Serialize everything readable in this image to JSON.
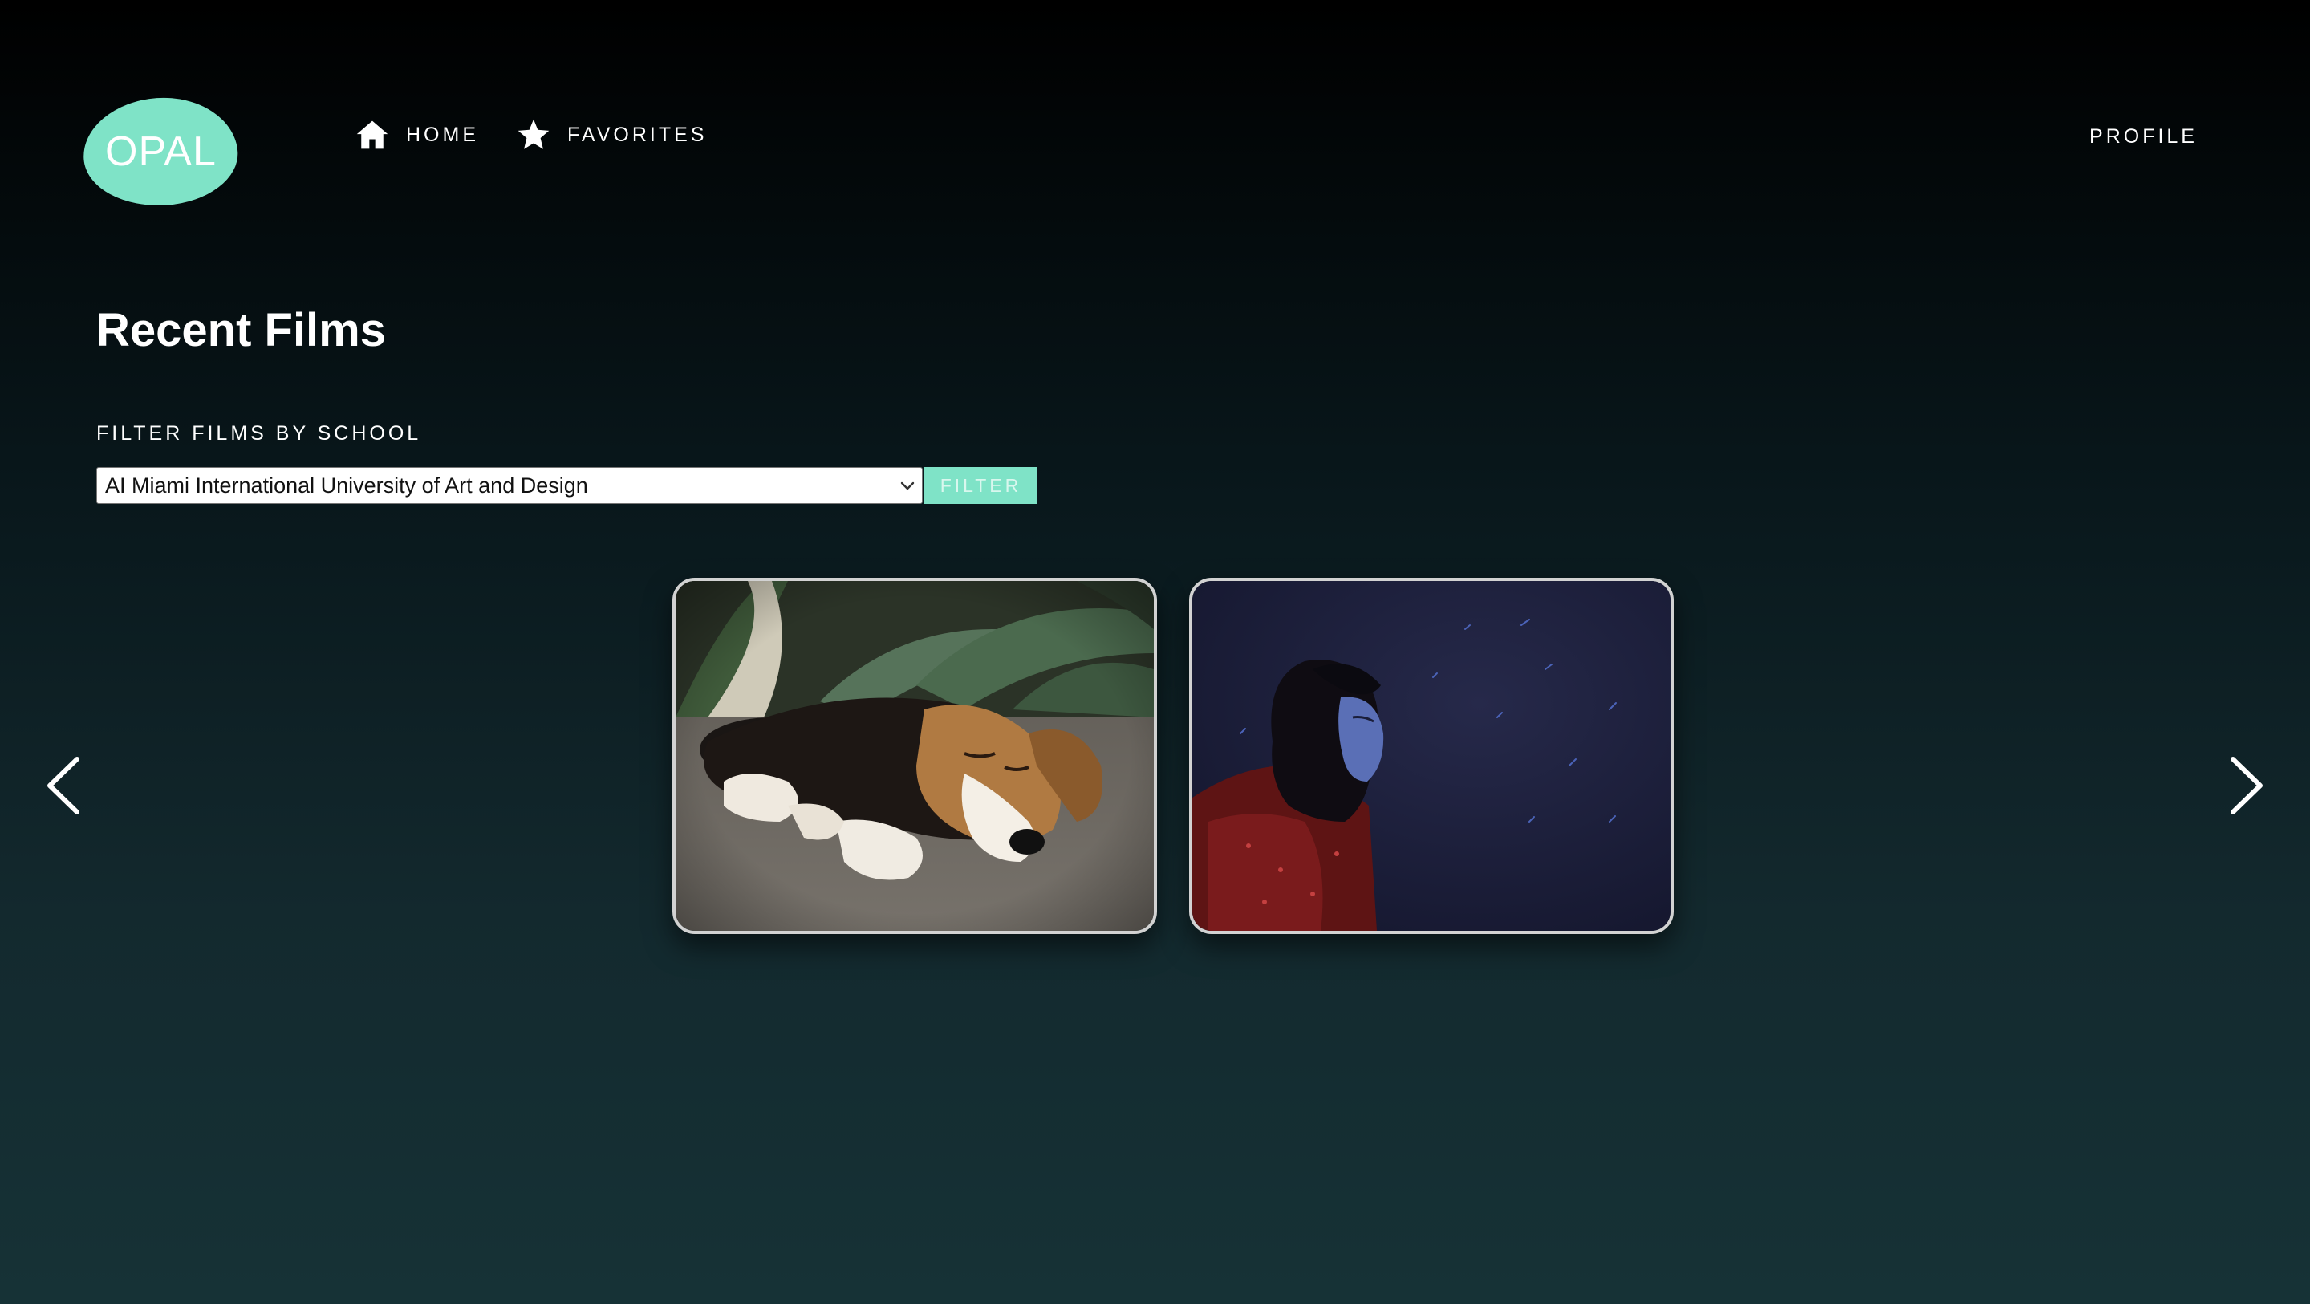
{
  "brand": {
    "logo_text": "OPAL",
    "logo_color": "#7fe3c7"
  },
  "nav": {
    "items": [
      {
        "label": "HOME",
        "icon": "home-icon"
      },
      {
        "label": "FAVORITES",
        "icon": "star-icon"
      }
    ],
    "profile_label": "PROFILE"
  },
  "main": {
    "title": "Recent Films",
    "filter": {
      "label": "FILTER FILMS BY SCHOOL",
      "selected_school": "AI Miami International University of Art and Design",
      "button_label": "FILTER"
    },
    "carousel": {
      "prev_icon": "chevron-left-icon",
      "next_icon": "chevron-right-icon",
      "films": [
        {
          "thumbnail": "sleeping-beagle-puppy"
        },
        {
          "thumbnail": "woman-in-red-jacket-under-night-sky"
        }
      ]
    }
  },
  "colors": {
    "accent": "#7fe3c7",
    "background_top": "#000000",
    "background_bottom": "#163236",
    "card_border": "#d2d2d2"
  }
}
